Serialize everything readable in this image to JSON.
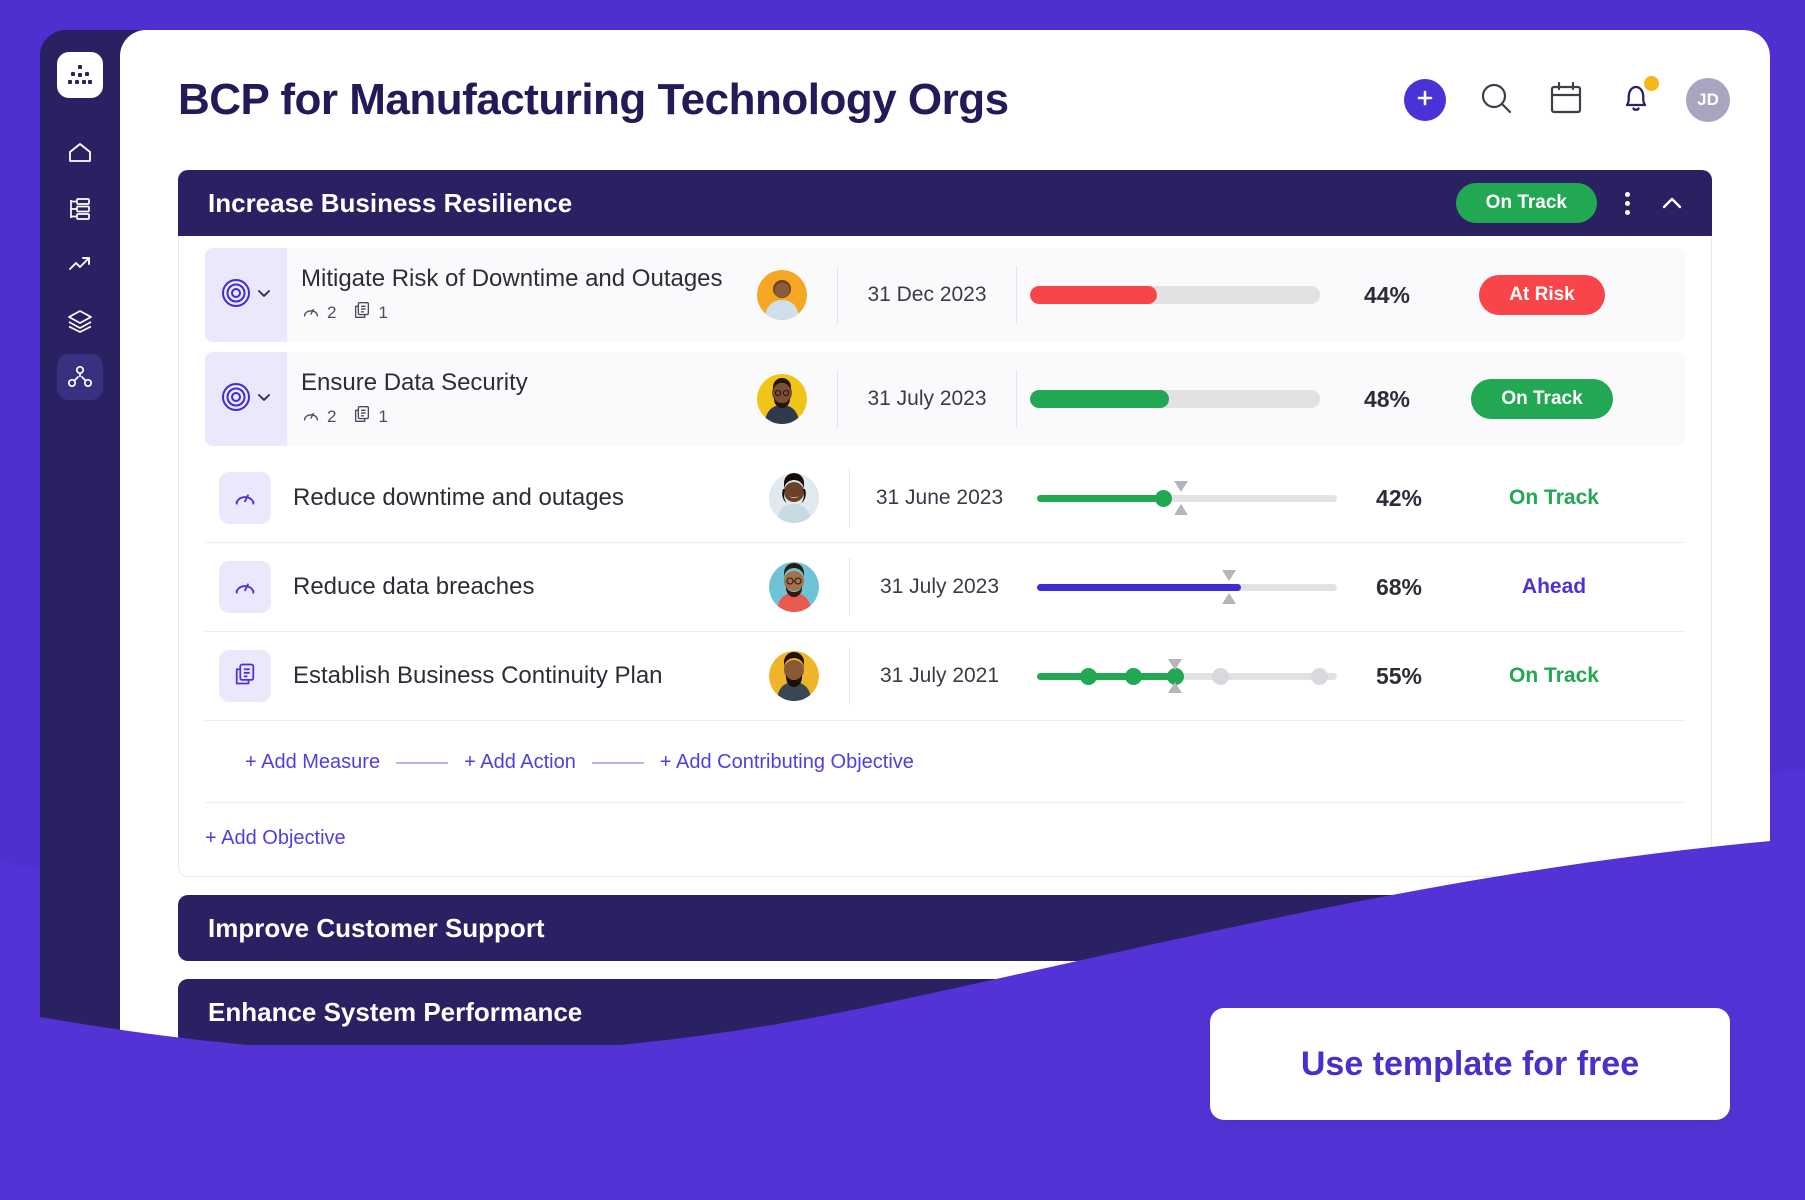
{
  "brand": {
    "accent": "#4a33d6",
    "dark_navy": "#2a2163",
    "green": "#22a852",
    "red": "#f8454a",
    "yellow": "#f7b718",
    "page_purple": "#4f2fcf"
  },
  "sidebar": {
    "items": [
      {
        "name": "logo",
        "icon": "app-logo-icon"
      },
      {
        "name": "home",
        "icon": "home-icon"
      },
      {
        "name": "reports",
        "icon": "org-chart-icon"
      },
      {
        "name": "analytics",
        "icon": "trend-up-icon"
      },
      {
        "name": "layers",
        "icon": "layers-icon"
      },
      {
        "name": "strategy-map",
        "icon": "network-nodes-icon"
      }
    ]
  },
  "header": {
    "title": "BCP for Manufacturing Technology Orgs",
    "actions": [
      {
        "name": "add",
        "icon": "plus-icon",
        "label": "+"
      },
      {
        "name": "search",
        "icon": "search-icon"
      },
      {
        "name": "calendar",
        "icon": "calendar-icon"
      },
      {
        "name": "notifications",
        "icon": "bell-icon",
        "has_badge": true
      }
    ],
    "avatar_initials": "JD"
  },
  "goals": [
    {
      "title": "Increase Business Resilience",
      "status": "On Track",
      "status_kind": "ontrack",
      "expanded": true,
      "objectives": [
        {
          "name": "Mitigate Risk of Downtime and Outages",
          "measures_count": "2",
          "actions_count": "1",
          "owner_avatar": "avatar-orange-man",
          "date": "31 Dec 2023",
          "progress": 44,
          "progress_label": "44%",
          "bar_color": "#f8454a",
          "status": "At Risk",
          "status_kind": "atrisk"
        },
        {
          "name": "Ensure Data Security",
          "measures_count": "2",
          "actions_count": "1",
          "owner_avatar": "avatar-yellow-man",
          "date": "31 July 2023",
          "progress": 48,
          "progress_label": "48%",
          "bar_color": "#22a852",
          "status": "On Track",
          "status_kind": "ontrack"
        }
      ],
      "measures": [
        {
          "name": "Reduce downtime and outages",
          "icon": "gauge-icon",
          "owner_avatar": "avatar-woman-dark",
          "date": "31 June 2023",
          "progress": 42,
          "progress_label": "42%",
          "marker_at": 48,
          "slider_color": "#22a852",
          "slider_type": "bar",
          "status": "On Track",
          "status_color": "#22a852"
        },
        {
          "name": "Reduce data breaches",
          "icon": "gauge-icon",
          "owner_avatar": "avatar-man-glasses",
          "date": "31 July 2023",
          "progress": 68,
          "progress_label": "68%",
          "marker_at": 64,
          "slider_color": "#3d2bd6",
          "slider_type": "bar",
          "status": "Ahead",
          "status_color": "#4a33d6"
        },
        {
          "name": "Establish Business Continuity Plan",
          "icon": "project-icon",
          "owner_avatar": "avatar-beard-man",
          "date": "31 July 2021",
          "progress": 55,
          "progress_label": "55%",
          "marker_at": 46,
          "slider_color": "#22a852",
          "slider_type": "milestones",
          "milestones": [
            {
              "at": 17,
              "done": true
            },
            {
              "at": 32,
              "done": true
            },
            {
              "at": 46,
              "done": true
            },
            {
              "at": 61,
              "done": false
            },
            {
              "at": 94,
              "done": false
            }
          ],
          "status": "On Track",
          "status_color": "#22a852"
        }
      ],
      "add_links": [
        "+ Add Measure",
        "+ Add Action",
        "+ Add Contributing Objective"
      ],
      "add_objective": "+ Add Objective"
    },
    {
      "title": "Improve Customer Support",
      "expanded": false
    },
    {
      "title": "Enhance System Performance",
      "expanded": false
    }
  ],
  "cta": {
    "label": "Use template for free"
  }
}
